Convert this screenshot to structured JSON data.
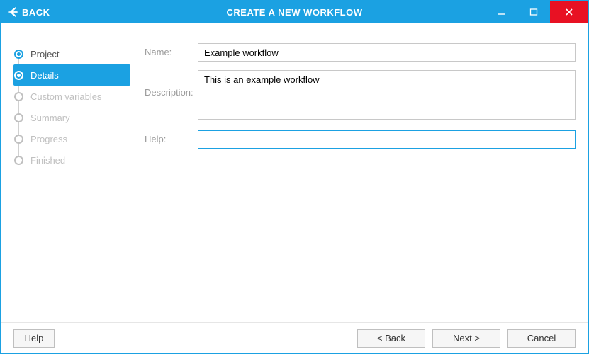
{
  "titlebar": {
    "back_label": "BACK",
    "title": "CREATE A NEW WORKFLOW"
  },
  "sidebar": {
    "steps": [
      {
        "label": "Project",
        "state": "done"
      },
      {
        "label": "Details",
        "state": "active"
      },
      {
        "label": "Custom variables",
        "state": "pending"
      },
      {
        "label": "Summary",
        "state": "pending"
      },
      {
        "label": "Progress",
        "state": "pending"
      },
      {
        "label": "Finished",
        "state": "pending"
      }
    ]
  },
  "form": {
    "name_label": "Name:",
    "name_value": "Example workflow",
    "description_label": "Description:",
    "description_value": "This is an example workflow",
    "help_label": "Help:",
    "help_value": ""
  },
  "footer": {
    "help_label": "Help",
    "back_label": "< Back",
    "next_label": "Next >",
    "cancel_label": "Cancel"
  }
}
